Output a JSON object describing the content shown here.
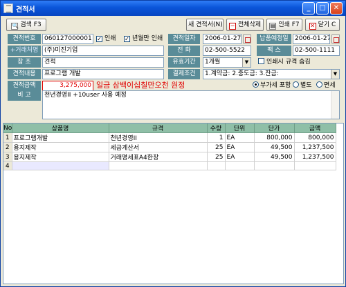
{
  "window": {
    "title": "견적서"
  },
  "toolbar": {
    "search": "검색 F3",
    "new": "새 견적서(N)",
    "delete": "전체삭제",
    "print": "인쇄 F7",
    "close": "닫기 C"
  },
  "form": {
    "est_no_label": "견적번호",
    "est_no": "060127000001",
    "print_label": "인쇄",
    "print_checked": true,
    "stamp_label": "년월만 인쇄",
    "stamp_checked": true,
    "est_date_label": "견적일자",
    "est_date": "2006-01-27",
    "due_date_label": "납품예정일",
    "due_date": "2006-01-27",
    "client_label": "+거래처명",
    "client": "(주)미진기업",
    "phone_label": "전    화",
    "phone": "02-500-5522",
    "fax_label": "팩    스",
    "fax": "02-500-1111",
    "ref_label": "참    조",
    "ref": "견적",
    "valid_label": "유효기간",
    "valid": "1개월",
    "hide_spec_label": "인쇄시 규격 숨김",
    "hide_spec_checked": false,
    "content_label": "견적내용",
    "content": "프로그램 개발",
    "terms_label": "결제조건",
    "terms": "1.계약금: 2.중도금: 3.잔금:",
    "amount_label": "견적금액",
    "amount": "3,275,000",
    "amount_words": "일금 삼백이십칠만오천 원정",
    "tax_options": [
      {
        "label": "부가세 포함",
        "selected": true
      },
      {
        "label": "별도",
        "selected": false
      },
      {
        "label": "면세",
        "selected": false
      }
    ],
    "note_label": "비    고",
    "note": "천년경영II +10user 사용 예정"
  },
  "grid": {
    "columns": [
      "No",
      "상품명",
      "규격",
      "수량",
      "단위",
      "단가",
      "금액"
    ],
    "rows": [
      [
        "1",
        "프로그램개발",
        "천년경영II",
        "1",
        "EA",
        "800,000",
        "800,000"
      ],
      [
        "2",
        "용지제작",
        "세금계산서",
        "25",
        "EA",
        "49,500",
        "1,237,500"
      ],
      [
        "3",
        "용지제작",
        "거래명세표A4한장",
        "25",
        "EA",
        "49,500",
        "1,237,500"
      ],
      [
        "4",
        "",
        "",
        "",
        "",
        "",
        ""
      ]
    ]
  },
  "colors": {
    "titlebar": "#0a55d9",
    "label_bg": "#5a8c98",
    "grid_header": "#8fbfa7",
    "amount_red": "#e00000"
  }
}
